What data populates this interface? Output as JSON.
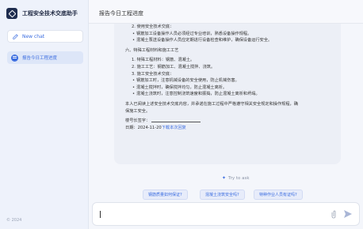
{
  "app": {
    "title": "工程安全技术交底助手"
  },
  "sidebar": {
    "new_chat": "New chat",
    "history": [
      {
        "label": "报告今日工程进度"
      }
    ],
    "copyright": "© 2024"
  },
  "header": {
    "title": "报告今日工程进度"
  },
  "message": {
    "lines": [
      {
        "text": "2. 使用安全技术交底：",
        "cls": "ol"
      },
      {
        "text": "钢筋加工设备操作人员必须经过专业培训，熟悉设备操作规程。",
        "cls": "bullets bullet"
      },
      {
        "text": "混凝土泵送设备操作人员应定期进行设备检查和维护，确保设备运行安全。",
        "cls": "bullets bullet"
      },
      {
        "text": "",
        "cls": "gap"
      },
      {
        "text": "六、特殊工程材料和施工工艺",
        "cls": ""
      },
      {
        "text": "",
        "cls": "gap"
      },
      {
        "text": "1. 特殊工程材料：钢筋、混凝土。",
        "cls": "ol"
      },
      {
        "text": "2. 施工工艺：钢筋加工、混凝土搅拌、浇筑。",
        "cls": "ol"
      },
      {
        "text": "3. 施工安全技术交底：",
        "cls": "ol"
      },
      {
        "text": "钢筋加工时，注意机械设备的安全使用，防止机械伤害。",
        "cls": "bullets bullet"
      },
      {
        "text": "混凝土搅拌时，确保搅拌均匀，防止混凝土离析。",
        "cls": "bullets bullet"
      },
      {
        "text": "混凝土浇筑时，注意控制浇筑速度和振捣，防止混凝土离析和坍塌。",
        "cls": "bullets bullet"
      },
      {
        "text": "",
        "cls": "gap"
      },
      {
        "text": "本人已阅读上述安全技术交底内容，并承诺在施工过程中严格遵守相关安全规定和操作规程，确",
        "cls": ""
      },
      {
        "text": "保施工安全。",
        "cls": ""
      },
      {
        "text": "",
        "cls": "gap"
      }
    ],
    "sign_label": "楼号长签字：",
    "date_label": "日期：2024-11-20",
    "download_link": "下载本次回复"
  },
  "suggestions": {
    "label": "Try to ask",
    "chips": [
      "钢筋质量如何保证?",
      "混凝土浇筑安全吗?",
      "特种作业人员有证吗?"
    ]
  },
  "composer": {
    "placeholder": ""
  }
}
